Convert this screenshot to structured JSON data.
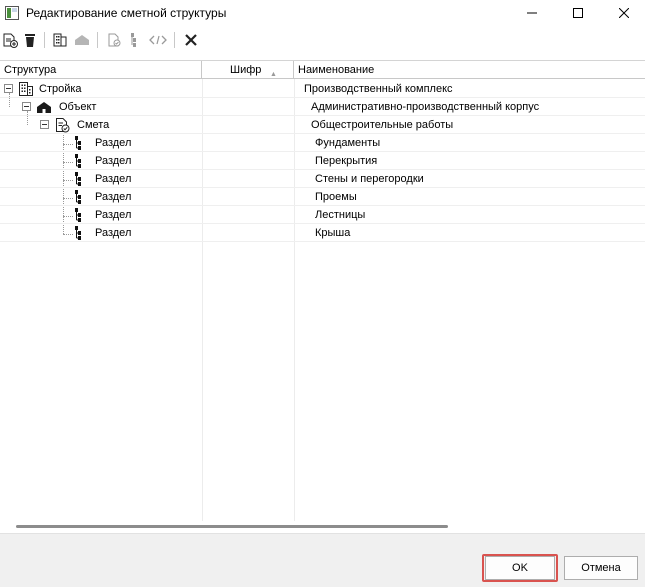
{
  "window": {
    "title": "Редактирование сметной структуры"
  },
  "toolbar": {
    "buttons": [
      "add-icon",
      "delete-icon",
      "building-icon",
      "house-icon",
      "estimate-icon",
      "section-icon",
      "code-icon",
      "close-x-icon"
    ]
  },
  "tree": {
    "columns": {
      "structure": "Структура",
      "cipher": "Шифр",
      "cipher_sort": "▲",
      "name": "Наименование"
    },
    "rows": [
      {
        "label": "Стройка",
        "name": "Производственный комплекс"
      },
      {
        "label": "Объект",
        "name": "Административно-производственный корпус"
      },
      {
        "label": "Смета",
        "name": "Общестроительные работы"
      },
      {
        "label": "Раздел",
        "name": "Фундаменты"
      },
      {
        "label": "Раздел",
        "name": "Перекрытия"
      },
      {
        "label": "Раздел",
        "name": "Стены и перегородки"
      },
      {
        "label": "Раздел",
        "name": "Проемы"
      },
      {
        "label": "Раздел",
        "name": "Лестницы"
      },
      {
        "label": "Раздел",
        "name": "Крыша"
      }
    ]
  },
  "footer": {
    "ok_label": "OK",
    "cancel_label": "Отмена"
  },
  "colors": {
    "highlight": "#d9534f"
  }
}
